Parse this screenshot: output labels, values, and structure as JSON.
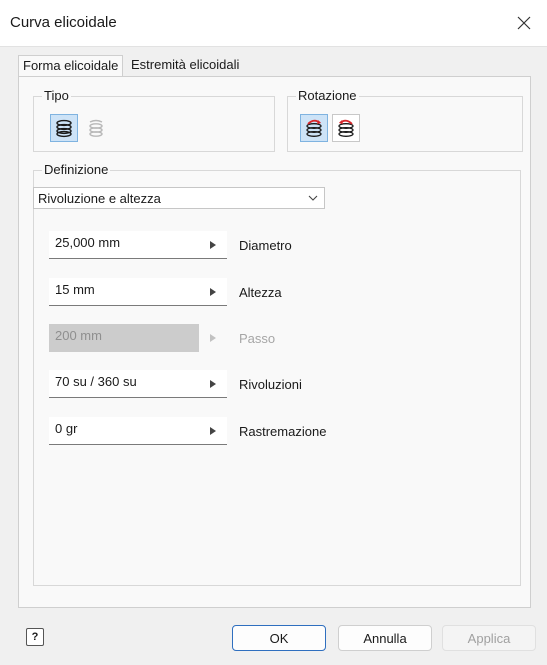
{
  "window": {
    "title": "Curva elicoidale"
  },
  "tabs": [
    {
      "label": "Forma elicoidale",
      "active": true
    },
    {
      "label": "Estremità elicoidali",
      "active": false
    }
  ],
  "groups": {
    "tipo": {
      "label": "Tipo"
    },
    "rotazione": {
      "label": "Rotazione"
    },
    "definizione": {
      "label": "Definizione"
    }
  },
  "definition_select": {
    "value": "Rivoluzione e altezza"
  },
  "fields": [
    {
      "value": "25,000 mm",
      "label": "Diametro",
      "disabled": false
    },
    {
      "value": "15 mm",
      "label": "Altezza",
      "disabled": false
    },
    {
      "value": "200 mm",
      "label": "Passo",
      "disabled": true
    },
    {
      "value": "70 su / 360 su",
      "label": "Rivoluzioni",
      "disabled": false
    },
    {
      "value": "0 gr",
      "label": "Rastremazione",
      "disabled": false
    }
  ],
  "footer": {
    "help_label": "?",
    "ok_label": "OK",
    "cancel_label": "Annulla",
    "apply_label": "Applica"
  },
  "colors": {
    "accent": "#2f6fbf",
    "selected_bg": "#cde3f7",
    "rotation_red": "#d8262b"
  },
  "icons": {
    "close": "close-icon",
    "coil": "coil-icon",
    "rotation": "rotation-icon",
    "arrow": "play-arrow-icon",
    "dropdown": "chevron-down-icon"
  }
}
